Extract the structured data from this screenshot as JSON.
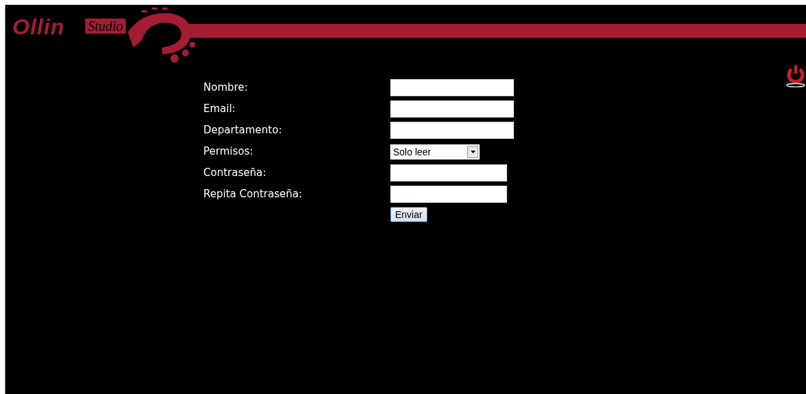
{
  "logo": {
    "word_1": "Ollin",
    "word_2": "Studio"
  },
  "form": {
    "fields": [
      {
        "label": "Nombre:",
        "kind": "text"
      },
      {
        "label": "Email:",
        "kind": "text"
      },
      {
        "label": "Departamento:",
        "kind": "text"
      },
      {
        "label": "Permisos:",
        "kind": "select",
        "value": "Solo leer"
      },
      {
        "label": "Contraseña:",
        "kind": "password"
      },
      {
        "label": "Repita Contraseña:",
        "kind": "password"
      }
    ],
    "submit": "Enviar"
  }
}
